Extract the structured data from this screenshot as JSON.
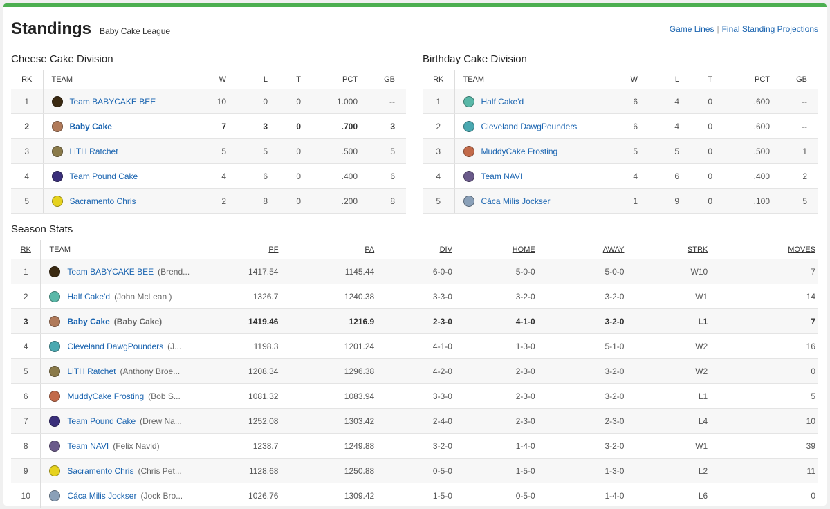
{
  "header": {
    "title": "Standings",
    "league": "Baby Cake League",
    "links": [
      "Game Lines",
      "Final Standing Projections"
    ]
  },
  "divisions": [
    {
      "name": "Cheese Cake Division",
      "columns": [
        "RK",
        "TEAM",
        "W",
        "L",
        "T",
        "PCT",
        "GB"
      ],
      "rows": [
        {
          "rk": "1",
          "team": "Team BABYCAKE BEE",
          "w": "10",
          "l": "0",
          "t": "0",
          "pct": "1.000",
          "gb": "--",
          "logo": "#3b2a12",
          "bold": false
        },
        {
          "rk": "2",
          "team": "Baby Cake",
          "w": "7",
          "l": "3",
          "t": "0",
          "pct": ".700",
          "gb": "3",
          "logo": "#b07a5a",
          "bold": true
        },
        {
          "rk": "3",
          "team": "LiTH Ratchet",
          "w": "5",
          "l": "5",
          "t": "0",
          "pct": ".500",
          "gb": "5",
          "logo": "#8a7a4a",
          "bold": false
        },
        {
          "rk": "4",
          "team": "Team Pound Cake",
          "w": "4",
          "l": "6",
          "t": "0",
          "pct": ".400",
          "gb": "6",
          "logo": "#3a2f7a",
          "bold": false
        },
        {
          "rk": "5",
          "team": "Sacramento Chris",
          "w": "2",
          "l": "8",
          "t": "0",
          "pct": ".200",
          "gb": "8",
          "logo": "#e6d21e",
          "bold": false
        }
      ]
    },
    {
      "name": "Birthday Cake Division",
      "columns": [
        "RK",
        "TEAM",
        "W",
        "L",
        "T",
        "PCT",
        "GB"
      ],
      "rows": [
        {
          "rk": "1",
          "team": "Half Cake'd",
          "w": "6",
          "l": "4",
          "t": "0",
          "pct": ".600",
          "gb": "--",
          "logo": "#5ab8a8",
          "bold": false
        },
        {
          "rk": "2",
          "team": "Cleveland DawgPounders",
          "w": "6",
          "l": "4",
          "t": "0",
          "pct": ".600",
          "gb": "--",
          "logo": "#4aa8b0",
          "bold": false
        },
        {
          "rk": "3",
          "team": "MuddyCake Frosting",
          "w": "5",
          "l": "5",
          "t": "0",
          "pct": ".500",
          "gb": "1",
          "logo": "#c26a4a",
          "bold": false
        },
        {
          "rk": "4",
          "team": "Team NAVI",
          "w": "4",
          "l": "6",
          "t": "0",
          "pct": ".400",
          "gb": "2",
          "logo": "#6a5a8a",
          "bold": false
        },
        {
          "rk": "5",
          "team": "Cáca Milis Jockser",
          "w": "1",
          "l": "9",
          "t": "0",
          "pct": ".100",
          "gb": "5",
          "logo": "#8aa0b8",
          "bold": false
        }
      ]
    }
  ],
  "season": {
    "title": "Season Stats",
    "columns": [
      "RK",
      "TEAM",
      "PF",
      "PA",
      "DIV",
      "HOME",
      "AWAY",
      "STRK",
      "MOVES"
    ],
    "rows": [
      {
        "rk": "1",
        "team": "Team BABYCAKE BEE",
        "owner": "(Brend...",
        "pf": "1417.54",
        "pa": "1145.44",
        "div": "6-0-0",
        "home": "5-0-0",
        "away": "5-0-0",
        "strk": "W10",
        "moves": "7",
        "logo": "#3b2a12",
        "bold": false
      },
      {
        "rk": "2",
        "team": "Half Cake'd",
        "owner": "(John McLean )",
        "pf": "1326.7",
        "pa": "1240.38",
        "div": "3-3-0",
        "home": "3-2-0",
        "away": "3-2-0",
        "strk": "W1",
        "moves": "14",
        "logo": "#5ab8a8",
        "bold": false
      },
      {
        "rk": "3",
        "team": "Baby Cake",
        "owner": "(Baby Cake)",
        "pf": "1419.46",
        "pa": "1216.9",
        "div": "2-3-0",
        "home": "4-1-0",
        "away": "3-2-0",
        "strk": "L1",
        "moves": "7",
        "logo": "#b07a5a",
        "bold": true
      },
      {
        "rk": "4",
        "team": "Cleveland DawgPounders",
        "owner": "(J...",
        "pf": "1198.3",
        "pa": "1201.24",
        "div": "4-1-0",
        "home": "1-3-0",
        "away": "5-1-0",
        "strk": "W2",
        "moves": "16",
        "logo": "#4aa8b0",
        "bold": false
      },
      {
        "rk": "5",
        "team": "LiTH Ratchet",
        "owner": "(Anthony Broe...",
        "pf": "1208.34",
        "pa": "1296.38",
        "div": "4-2-0",
        "home": "2-3-0",
        "away": "3-2-0",
        "strk": "W2",
        "moves": "0",
        "logo": "#8a7a4a",
        "bold": false
      },
      {
        "rk": "6",
        "team": "MuddyCake Frosting",
        "owner": "(Bob S...",
        "pf": "1081.32",
        "pa": "1083.94",
        "div": "3-3-0",
        "home": "2-3-0",
        "away": "3-2-0",
        "strk": "L1",
        "moves": "5",
        "logo": "#c26a4a",
        "bold": false
      },
      {
        "rk": "7",
        "team": "Team Pound Cake",
        "owner": "(Drew Na...",
        "pf": "1252.08",
        "pa": "1303.42",
        "div": "2-4-0",
        "home": "2-3-0",
        "away": "2-3-0",
        "strk": "L4",
        "moves": "10",
        "logo": "#3a2f7a",
        "bold": false
      },
      {
        "rk": "8",
        "team": "Team NAVI",
        "owner": "(Felix Navid)",
        "pf": "1238.7",
        "pa": "1249.88",
        "div": "3-2-0",
        "home": "1-4-0",
        "away": "3-2-0",
        "strk": "W1",
        "moves": "39",
        "logo": "#6a5a8a",
        "bold": false
      },
      {
        "rk": "9",
        "team": "Sacramento Chris",
        "owner": "(Chris Pet...",
        "pf": "1128.68",
        "pa": "1250.88",
        "div": "0-5-0",
        "home": "1-5-0",
        "away": "1-3-0",
        "strk": "L2",
        "moves": "11",
        "logo": "#e6d21e",
        "bold": false
      },
      {
        "rk": "10",
        "team": "Cáca Milis Jockser",
        "owner": "(Jock Bro...",
        "pf": "1026.76",
        "pa": "1309.42",
        "div": "1-5-0",
        "home": "0-5-0",
        "away": "1-4-0",
        "strk": "L6",
        "moves": "0",
        "logo": "#8aa0b8",
        "bold": false
      }
    ]
  }
}
